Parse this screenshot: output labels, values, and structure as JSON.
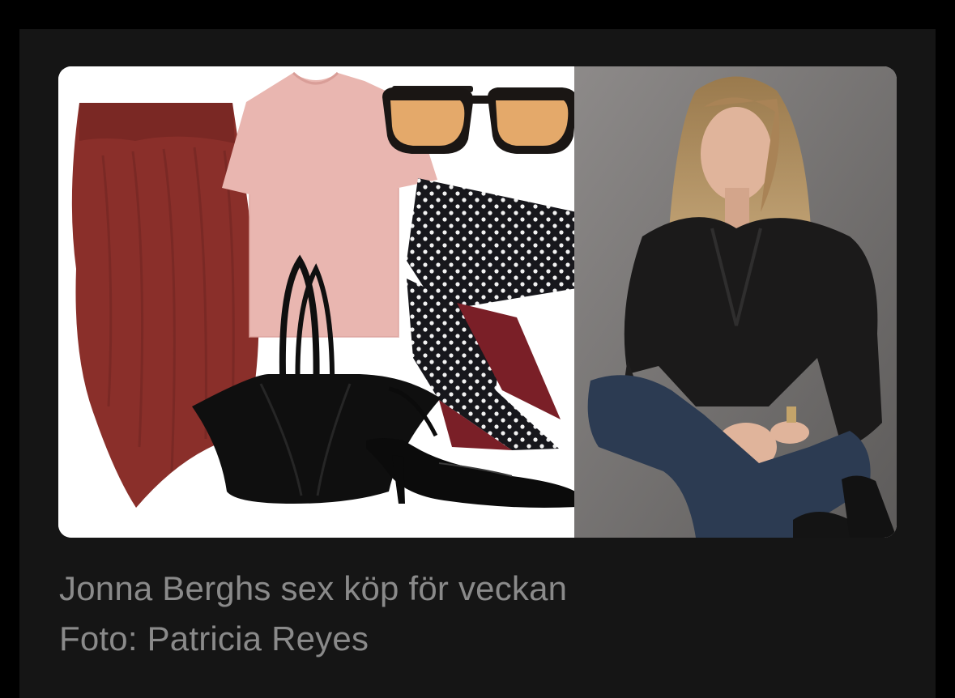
{
  "article": {
    "image_alt": "Collage of clothing items and portrait photo",
    "caption_title": "Jonna Berghs sex köp för veckan",
    "caption_credit": "Foto: Patricia Reyes"
  },
  "colors": {
    "page_background": "#000000",
    "panel_background": "#151515",
    "caption_text": "#8a8a8a"
  },
  "collage_items": [
    {
      "name": "burgundy-skirt"
    },
    {
      "name": "pink-tshirt"
    },
    {
      "name": "tinted-sunglasses"
    },
    {
      "name": "polka-dot-scarf"
    },
    {
      "name": "black-tote-bag"
    },
    {
      "name": "patent-slingback-heels"
    }
  ]
}
